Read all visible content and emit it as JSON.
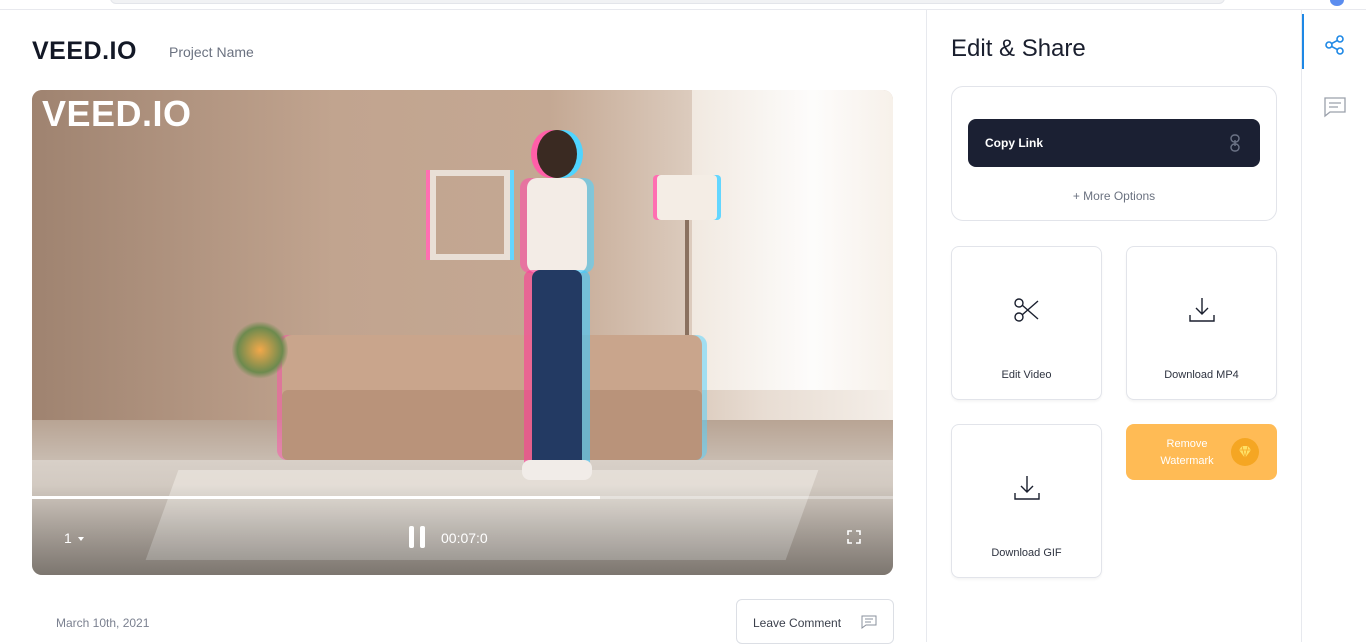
{
  "header": {
    "logo": "VEED.IO",
    "project_name": "Project Name"
  },
  "player": {
    "watermark": "VEED.IO",
    "speed": "1",
    "time": "00:07:0",
    "progress_fraction": 0.66,
    "state": "playing"
  },
  "footer": {
    "date": "March 10th, 2021",
    "leave_comment": "Leave Comment"
  },
  "panel": {
    "title": "Edit & Share",
    "copy_link": "Copy Link",
    "more_options": "+ More Options",
    "tiles": [
      {
        "label": "Edit Video",
        "icon": "scissors-icon"
      },
      {
        "label": "Download MP4",
        "icon": "download-icon"
      },
      {
        "label": "Download GIF",
        "icon": "download-icon"
      }
    ],
    "remove_watermark": "Remove Watermark"
  },
  "colors": {
    "accent_blue": "#1e88e5",
    "dark_button": "#1b2033",
    "watermark_orange": "#ffbb55"
  },
  "rail": {
    "icons": [
      "share-icon",
      "comments-icon"
    ]
  }
}
